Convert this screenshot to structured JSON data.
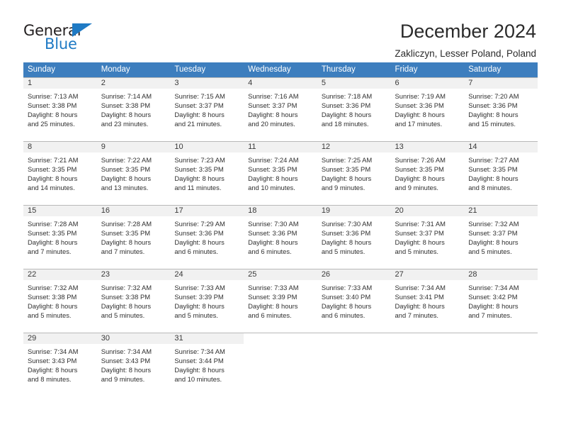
{
  "logo": {
    "word_top": "General",
    "word_bottom": "Blue",
    "triangle_color": "#1f7ac4"
  },
  "header": {
    "title": "December 2024",
    "subtitle": "Zakliczyn, Lesser Poland, Poland"
  },
  "theme": {
    "header_blue": "#3d7ebe",
    "daynum_band": "#f1f1f1",
    "grid_line": "#b9b9b9",
    "text": "#2f2f2f"
  },
  "weekday_headers": [
    "Sunday",
    "Monday",
    "Tuesday",
    "Wednesday",
    "Thursday",
    "Friday",
    "Saturday"
  ],
  "weeks": [
    [
      {
        "day": "1",
        "sunrise": "Sunrise: 7:13 AM",
        "sunset": "Sunset: 3:38 PM",
        "daylight_1": "Daylight: 8 hours",
        "daylight_2": "and 25 minutes."
      },
      {
        "day": "2",
        "sunrise": "Sunrise: 7:14 AM",
        "sunset": "Sunset: 3:38 PM",
        "daylight_1": "Daylight: 8 hours",
        "daylight_2": "and 23 minutes."
      },
      {
        "day": "3",
        "sunrise": "Sunrise: 7:15 AM",
        "sunset": "Sunset: 3:37 PM",
        "daylight_1": "Daylight: 8 hours",
        "daylight_2": "and 21 minutes."
      },
      {
        "day": "4",
        "sunrise": "Sunrise: 7:16 AM",
        "sunset": "Sunset: 3:37 PM",
        "daylight_1": "Daylight: 8 hours",
        "daylight_2": "and 20 minutes."
      },
      {
        "day": "5",
        "sunrise": "Sunrise: 7:18 AM",
        "sunset": "Sunset: 3:36 PM",
        "daylight_1": "Daylight: 8 hours",
        "daylight_2": "and 18 minutes."
      },
      {
        "day": "6",
        "sunrise": "Sunrise: 7:19 AM",
        "sunset": "Sunset: 3:36 PM",
        "daylight_1": "Daylight: 8 hours",
        "daylight_2": "and 17 minutes."
      },
      {
        "day": "7",
        "sunrise": "Sunrise: 7:20 AM",
        "sunset": "Sunset: 3:36 PM",
        "daylight_1": "Daylight: 8 hours",
        "daylight_2": "and 15 minutes."
      }
    ],
    [
      {
        "day": "8",
        "sunrise": "Sunrise: 7:21 AM",
        "sunset": "Sunset: 3:35 PM",
        "daylight_1": "Daylight: 8 hours",
        "daylight_2": "and 14 minutes."
      },
      {
        "day": "9",
        "sunrise": "Sunrise: 7:22 AM",
        "sunset": "Sunset: 3:35 PM",
        "daylight_1": "Daylight: 8 hours",
        "daylight_2": "and 13 minutes."
      },
      {
        "day": "10",
        "sunrise": "Sunrise: 7:23 AM",
        "sunset": "Sunset: 3:35 PM",
        "daylight_1": "Daylight: 8 hours",
        "daylight_2": "and 11 minutes."
      },
      {
        "day": "11",
        "sunrise": "Sunrise: 7:24 AM",
        "sunset": "Sunset: 3:35 PM",
        "daylight_1": "Daylight: 8 hours",
        "daylight_2": "and 10 minutes."
      },
      {
        "day": "12",
        "sunrise": "Sunrise: 7:25 AM",
        "sunset": "Sunset: 3:35 PM",
        "daylight_1": "Daylight: 8 hours",
        "daylight_2": "and 9 minutes."
      },
      {
        "day": "13",
        "sunrise": "Sunrise: 7:26 AM",
        "sunset": "Sunset: 3:35 PM",
        "daylight_1": "Daylight: 8 hours",
        "daylight_2": "and 9 minutes."
      },
      {
        "day": "14",
        "sunrise": "Sunrise: 7:27 AM",
        "sunset": "Sunset: 3:35 PM",
        "daylight_1": "Daylight: 8 hours",
        "daylight_2": "and 8 minutes."
      }
    ],
    [
      {
        "day": "15",
        "sunrise": "Sunrise: 7:28 AM",
        "sunset": "Sunset: 3:35 PM",
        "daylight_1": "Daylight: 8 hours",
        "daylight_2": "and 7 minutes."
      },
      {
        "day": "16",
        "sunrise": "Sunrise: 7:28 AM",
        "sunset": "Sunset: 3:35 PM",
        "daylight_1": "Daylight: 8 hours",
        "daylight_2": "and 7 minutes."
      },
      {
        "day": "17",
        "sunrise": "Sunrise: 7:29 AM",
        "sunset": "Sunset: 3:36 PM",
        "daylight_1": "Daylight: 8 hours",
        "daylight_2": "and 6 minutes."
      },
      {
        "day": "18",
        "sunrise": "Sunrise: 7:30 AM",
        "sunset": "Sunset: 3:36 PM",
        "daylight_1": "Daylight: 8 hours",
        "daylight_2": "and 6 minutes."
      },
      {
        "day": "19",
        "sunrise": "Sunrise: 7:30 AM",
        "sunset": "Sunset: 3:36 PM",
        "daylight_1": "Daylight: 8 hours",
        "daylight_2": "and 5 minutes."
      },
      {
        "day": "20",
        "sunrise": "Sunrise: 7:31 AM",
        "sunset": "Sunset: 3:37 PM",
        "daylight_1": "Daylight: 8 hours",
        "daylight_2": "and 5 minutes."
      },
      {
        "day": "21",
        "sunrise": "Sunrise: 7:32 AM",
        "sunset": "Sunset: 3:37 PM",
        "daylight_1": "Daylight: 8 hours",
        "daylight_2": "and 5 minutes."
      }
    ],
    [
      {
        "day": "22",
        "sunrise": "Sunrise: 7:32 AM",
        "sunset": "Sunset: 3:38 PM",
        "daylight_1": "Daylight: 8 hours",
        "daylight_2": "and 5 minutes."
      },
      {
        "day": "23",
        "sunrise": "Sunrise: 7:32 AM",
        "sunset": "Sunset: 3:38 PM",
        "daylight_1": "Daylight: 8 hours",
        "daylight_2": "and 5 minutes."
      },
      {
        "day": "24",
        "sunrise": "Sunrise: 7:33 AM",
        "sunset": "Sunset: 3:39 PM",
        "daylight_1": "Daylight: 8 hours",
        "daylight_2": "and 5 minutes."
      },
      {
        "day": "25",
        "sunrise": "Sunrise: 7:33 AM",
        "sunset": "Sunset: 3:39 PM",
        "daylight_1": "Daylight: 8 hours",
        "daylight_2": "and 6 minutes."
      },
      {
        "day": "26",
        "sunrise": "Sunrise: 7:33 AM",
        "sunset": "Sunset: 3:40 PM",
        "daylight_1": "Daylight: 8 hours",
        "daylight_2": "and 6 minutes."
      },
      {
        "day": "27",
        "sunrise": "Sunrise: 7:34 AM",
        "sunset": "Sunset: 3:41 PM",
        "daylight_1": "Daylight: 8 hours",
        "daylight_2": "and 7 minutes."
      },
      {
        "day": "28",
        "sunrise": "Sunrise: 7:34 AM",
        "sunset": "Sunset: 3:42 PM",
        "daylight_1": "Daylight: 8 hours",
        "daylight_2": "and 7 minutes."
      }
    ],
    [
      {
        "day": "29",
        "sunrise": "Sunrise: 7:34 AM",
        "sunset": "Sunset: 3:43 PM",
        "daylight_1": "Daylight: 8 hours",
        "daylight_2": "and 8 minutes."
      },
      {
        "day": "30",
        "sunrise": "Sunrise: 7:34 AM",
        "sunset": "Sunset: 3:43 PM",
        "daylight_1": "Daylight: 8 hours",
        "daylight_2": "and 9 minutes."
      },
      {
        "day": "31",
        "sunrise": "Sunrise: 7:34 AM",
        "sunset": "Sunset: 3:44 PM",
        "daylight_1": "Daylight: 8 hours",
        "daylight_2": "and 10 minutes."
      },
      {
        "day": "",
        "sunrise": "",
        "sunset": "",
        "daylight_1": "",
        "daylight_2": ""
      },
      {
        "day": "",
        "sunrise": "",
        "sunset": "",
        "daylight_1": "",
        "daylight_2": ""
      },
      {
        "day": "",
        "sunrise": "",
        "sunset": "",
        "daylight_1": "",
        "daylight_2": ""
      },
      {
        "day": "",
        "sunrise": "",
        "sunset": "",
        "daylight_1": "",
        "daylight_2": ""
      }
    ]
  ]
}
